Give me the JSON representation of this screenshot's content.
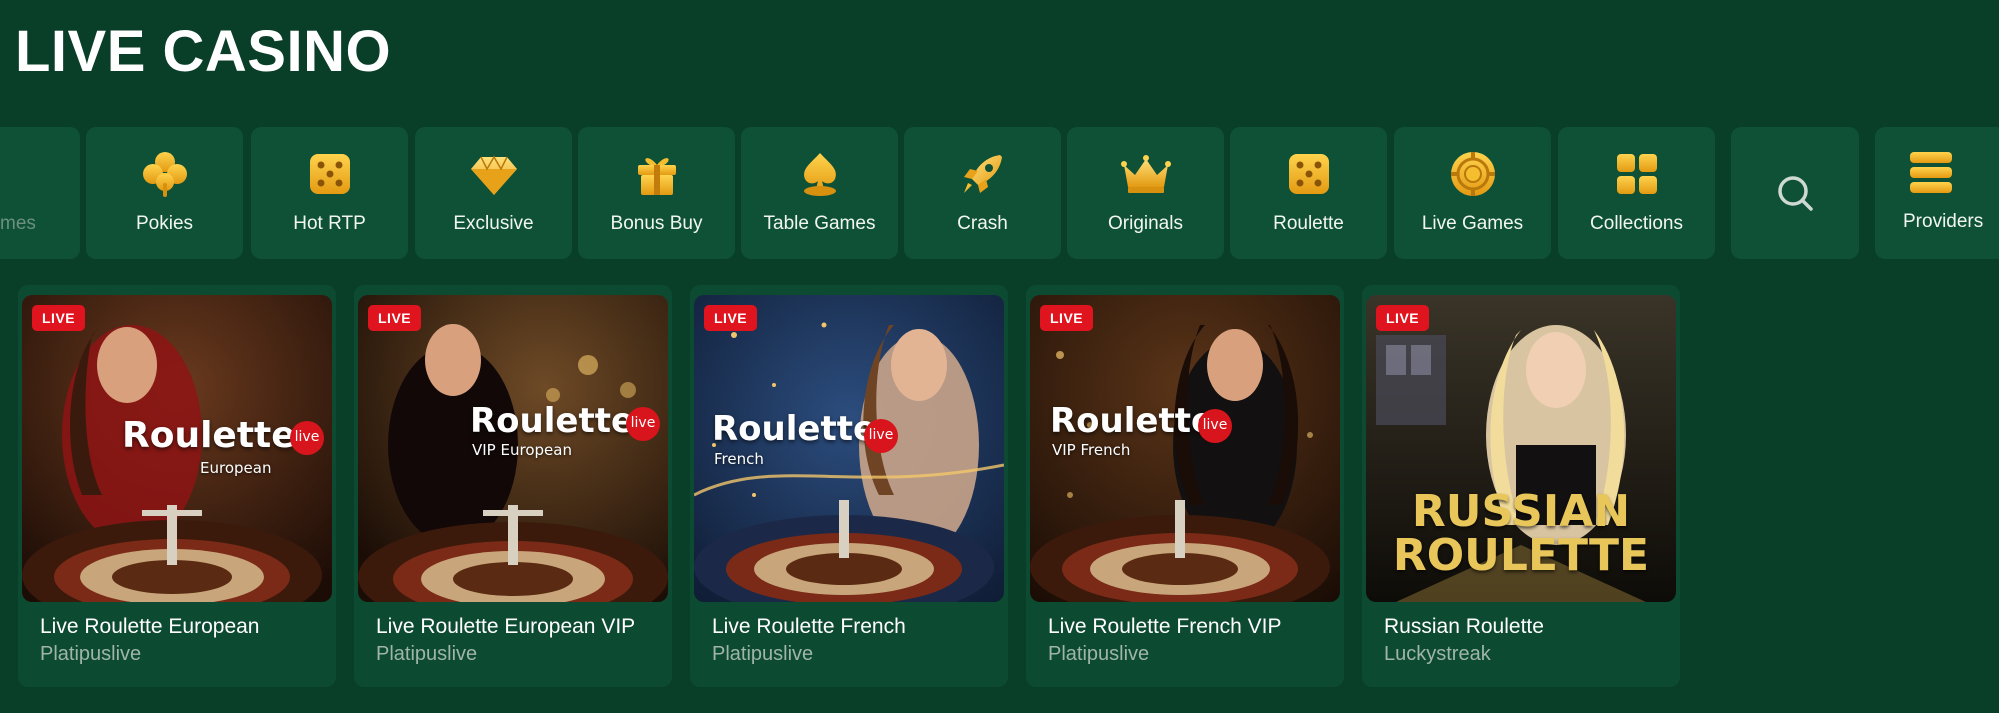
{
  "page": {
    "title": "LIVE CASINO"
  },
  "colors": {
    "background": "#093e29",
    "tile": "#0e5136",
    "card": "#0d4a32",
    "gold_icon": "#f2b51c",
    "live_badge": "#e0141e",
    "provider_text": "#9fb5a9"
  },
  "categories": [
    {
      "label": "mes",
      "icon": "partial-tile"
    },
    {
      "label": "Pokies",
      "icon": "clover-icon"
    },
    {
      "label": "Hot RTP",
      "icon": "dice-icon"
    },
    {
      "label": "Exclusive",
      "icon": "diamond-icon"
    },
    {
      "label": "Bonus Buy",
      "icon": "gift-icon"
    },
    {
      "label": "Table Games",
      "icon": "spade-chip-icon"
    },
    {
      "label": "Crash",
      "icon": "rocket-icon"
    },
    {
      "label": "Originals",
      "icon": "crown-icon"
    },
    {
      "label": "Roulette",
      "icon": "dice-icon"
    },
    {
      "label": "Live Games",
      "icon": "chip-icon"
    },
    {
      "label": "Collections",
      "icon": "grid-icon"
    },
    {
      "label": "",
      "icon": "search-icon"
    },
    {
      "label": "Providers",
      "icon": "stack-icon"
    }
  ],
  "games": [
    {
      "badge": "LIVE",
      "name": "Live Roulette European",
      "provider": "Platipuslive",
      "thumb_title": "Roulette",
      "thumb_sub": "European",
      "thumb_live": "live"
    },
    {
      "badge": "LIVE",
      "name": "Live Roulette European VIP",
      "provider": "Platipuslive",
      "thumb_title": "Roulette",
      "thumb_sub": "VIP European",
      "thumb_live": "live"
    },
    {
      "badge": "LIVE",
      "name": "Live Roulette French",
      "provider": "Platipuslive",
      "thumb_title": "Roulette",
      "thumb_sub": "French",
      "thumb_live": "live"
    },
    {
      "badge": "LIVE",
      "name": "Live Roulette French VIP",
      "provider": "Platipuslive",
      "thumb_title": "Roulette",
      "thumb_sub": "VIP French",
      "thumb_live": "live"
    },
    {
      "badge": "LIVE",
      "name": "Russian Roulette",
      "provider": "Luckystreak",
      "thumb_title_line1": "RUSSIAN",
      "thumb_title_line2": "ROULETTE"
    }
  ]
}
